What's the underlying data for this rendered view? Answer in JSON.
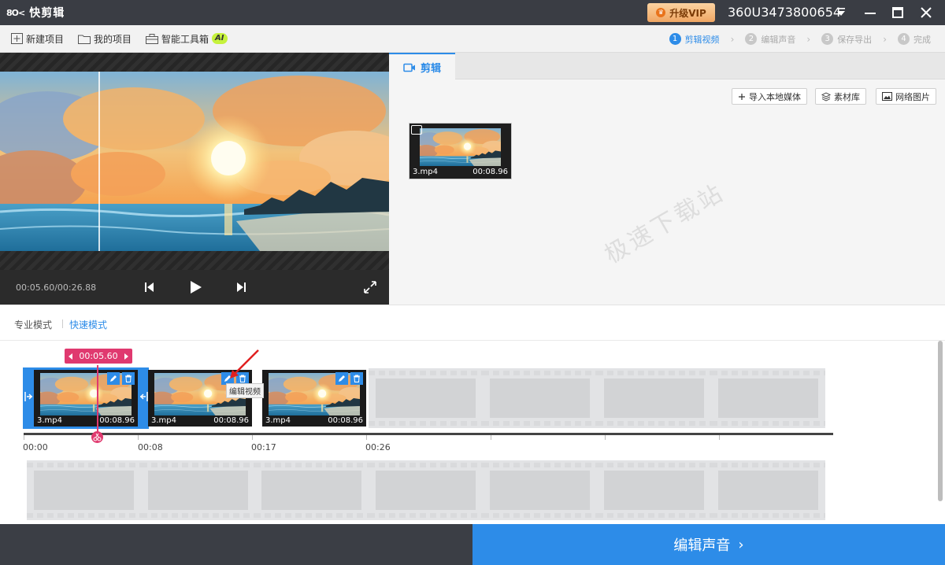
{
  "app": {
    "logo_text": "8O<",
    "title": "快剪辑"
  },
  "titlebar": {
    "vip_label": "升级VIP",
    "username": "360U3473800654"
  },
  "toolbar": {
    "new_project": "新建项目",
    "my_projects": "我的项目",
    "smart_tools": "智能工具箱",
    "ai_badge": "AI"
  },
  "steps": [
    {
      "num": "1",
      "label": "剪辑视频",
      "active": true
    },
    {
      "num": "2",
      "label": "编辑声音",
      "active": false
    },
    {
      "num": "3",
      "label": "保存导出",
      "active": false
    },
    {
      "num": "4",
      "label": "完成",
      "active": false
    }
  ],
  "preview": {
    "time": "00:05.60/00:26.88",
    "progress": 0.2083
  },
  "media": {
    "tab_label": "剪辑",
    "buttons": {
      "import": "导入本地媒体",
      "library": "素材库",
      "web_images": "网络图片"
    },
    "items": [
      {
        "name": "3.mp4",
        "duration": "00:08.96"
      }
    ],
    "watermark": "极速下载站"
  },
  "modes": {
    "pro": "专业模式",
    "fast": "快速模式"
  },
  "timeline": {
    "playhead_time": "00:05.60",
    "clips": [
      {
        "name": "3.mp4",
        "duration": "00:08.96",
        "selected": true
      },
      {
        "name": "3.mp4",
        "duration": "00:08.96",
        "selected": false
      },
      {
        "name": "3.mp4",
        "duration": "00:08.96",
        "selected": false
      }
    ],
    "tooltip": "编辑视频",
    "ruler_labels": [
      "00:00",
      "00:08",
      "00:17",
      "00:26"
    ]
  },
  "footer": {
    "next_label": "编辑声音"
  },
  "colors": {
    "accent": "#2d8ce8",
    "playhead": "#e0396f",
    "titlebar": "#3a3d44",
    "vip": "#f0a663"
  }
}
